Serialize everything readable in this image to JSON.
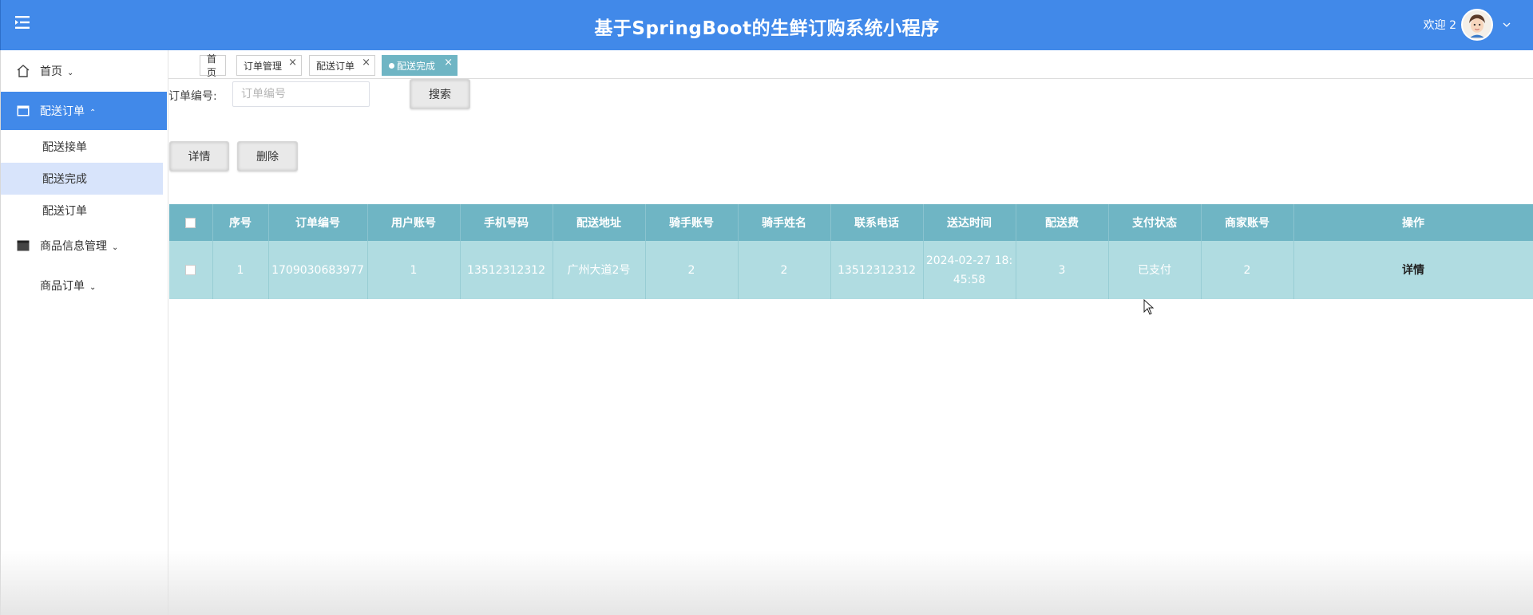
{
  "header": {
    "title": "基于SpringBoot的生鲜订购系统小程序",
    "welcome": "欢迎 2",
    "brand_color": "#4189e9"
  },
  "sidebar": {
    "items": [
      {
        "label": "首页",
        "icon": "home-icon"
      },
      {
        "label": "配送订单",
        "icon": "window-icon"
      },
      {
        "label": "配送接单"
      },
      {
        "label": "配送完成"
      },
      {
        "label": "配送订单"
      },
      {
        "label": "商品信息管理",
        "icon": "folder-icon"
      },
      {
        "label": "商品订单"
      }
    ]
  },
  "tabs": [
    {
      "label": "首页"
    },
    {
      "label": "订单管理"
    },
    {
      "label": "配送订单"
    },
    {
      "label": "配送完成"
    }
  ],
  "search": {
    "label": "订单编号:",
    "placeholder": "订单编号",
    "button": "搜索"
  },
  "actions": {
    "detail": "详情",
    "delete": "删除"
  },
  "table": {
    "headers": [
      "序号",
      "订单编号",
      "用户账号",
      "手机号码",
      "配送地址",
      "骑手账号",
      "骑手姓名",
      "联系电话",
      "送达时间",
      "配送费",
      "支付状态",
      "商家账号",
      "操作"
    ],
    "rows": [
      {
        "index": "1",
        "order_no": "1709030683977",
        "user": "1",
        "phone": "13512312312",
        "address": "广州大道2号",
        "rider_account": "2",
        "rider_name": "2",
        "contact": "13512312312",
        "time_line1": "2024-02-27 18:",
        "time_line2": "45:58",
        "fee": "3",
        "pay_status": "已支付",
        "merchant": "2",
        "op": "详情"
      }
    ]
  },
  "colors": {
    "table_header": "#6fb5c4",
    "table_row": "#b0dce1",
    "active_sub": "#d8e4fb"
  }
}
